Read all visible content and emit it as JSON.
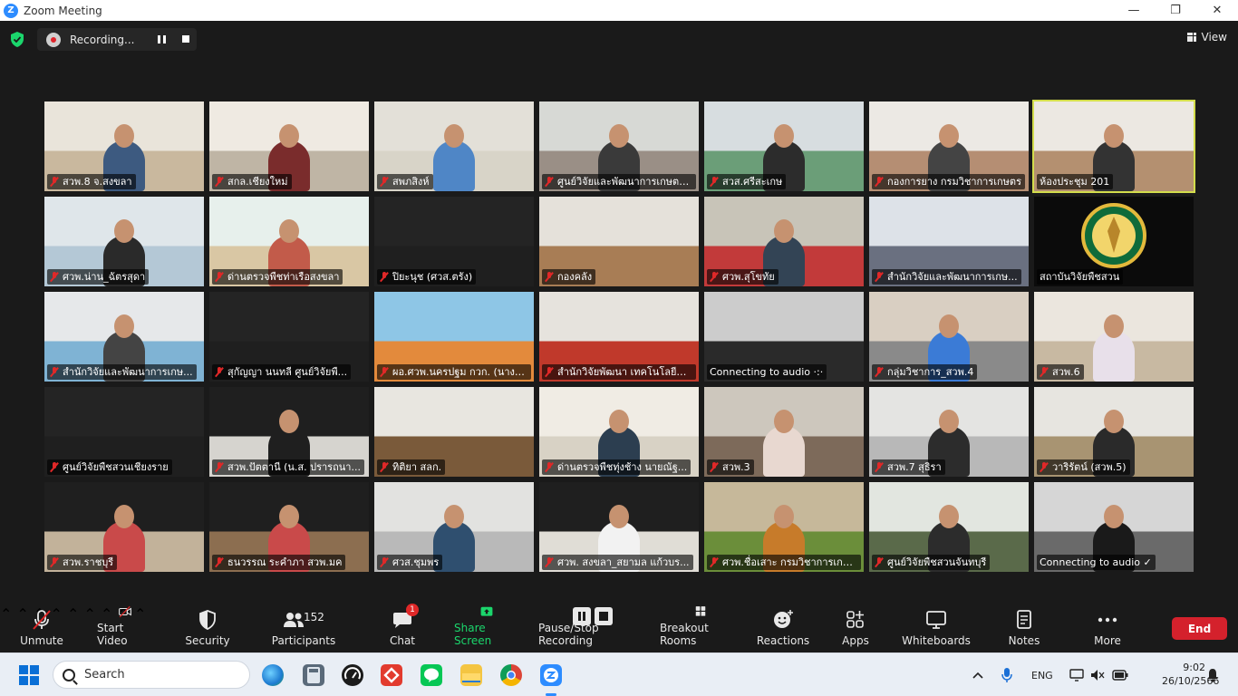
{
  "window": {
    "title": "Zoom Meeting",
    "logo_letter": "Z",
    "minimize": "—",
    "maximize": "❐",
    "close": "✕"
  },
  "topbar": {
    "recording_label": "Recording...",
    "view_label": "View"
  },
  "tiles": [
    {
      "label": "สวพ.8 จ.สงขลา",
      "muted": true,
      "bg": "#c9b89e",
      "wall": "#e9e4da",
      "person": "#3d5a80"
    },
    {
      "label": "สกล.เชียงใหม่",
      "muted": true,
      "bg": "#bfb5a5",
      "wall": "#efeae2",
      "person": "#7a2c2c"
    },
    {
      "label": "สพภสิงห์",
      "muted": true,
      "bg": "#d8d4c8",
      "wall": "#e3e0d8",
      "person": "#4f86c6"
    },
    {
      "label": "ศูนย์วิจัยและพัฒนาการเกษตร...",
      "muted": true,
      "bg": "#9a8f86",
      "wall": "#d7d9d5",
      "person": "#3a3a3a"
    },
    {
      "label": "สวส.ศรีสะเกษ",
      "muted": true,
      "bg": "#6b9e78",
      "wall": "#d7dde0",
      "person": "#2c2c2c"
    },
    {
      "label": "กองการยาง กรมวิชาการเกษตร",
      "muted": true,
      "bg": "#b58e73",
      "wall": "#ece9e4",
      "person": "#444444"
    },
    {
      "label": "ห้องประชุม 201",
      "muted": false,
      "bg": "#b49070",
      "wall": "#ece8e2",
      "person": "#333333"
    },
    {
      "label": "ศวพ.น่าน_ฉัตรสุดา",
      "muted": true,
      "bg": "#b4c8d6",
      "wall": "#dfe6ea",
      "person": "#2a2a2a"
    },
    {
      "label": "ด่านตรวจพืชท่าเรือสงขลา",
      "muted": true,
      "bg": "#d9c7a4",
      "wall": "#e7f0ec",
      "person": "#c25b4a"
    },
    {
      "label": "ปิยะนุช (ศวส.ตรัง)",
      "muted": true,
      "bg": "#1f1f1f",
      "wall": "#242424",
      "person": ""
    },
    {
      "label": "กองคลัง",
      "muted": true,
      "bg": "#a87d55",
      "wall": "#e5e1da",
      "person": ""
    },
    {
      "label": "ศวพ.สุโขทัย",
      "muted": true,
      "bg": "#c23a3a",
      "wall": "#c8c4b8",
      "person": "#334455"
    },
    {
      "label": "สำนักวิจัยและพัฒนาการเกษ...",
      "muted": true,
      "bg": "#6a7080",
      "wall": "#dde2e8",
      "person": ""
    },
    {
      "label": "สถาบันวิจัยพืชสวน",
      "muted": false,
      "bg": "#0b0b0b",
      "wall": "#0b0b0b",
      "person": "",
      "emblem": true
    },
    {
      "label": "สำนักวิจัยและพัฒนาการเกษ...",
      "muted": true,
      "bg": "#7fb3d4",
      "wall": "#e6e8ea",
      "person": "#444444"
    },
    {
      "label": "สุกัญญา นนทลี ศูนย์วิจัยพื...",
      "muted": true,
      "bg": "#1f1f1f",
      "wall": "#242424",
      "person": ""
    },
    {
      "label": "ผอ.ศวพ.นครปฐม กวก. (นางเ...",
      "muted": true,
      "bg": "#e38a3c",
      "wall": "#8ec6e6",
      "person": ""
    },
    {
      "label": "สำนักวิจัยพัฒนา เทคโนโลยีชี...",
      "muted": true,
      "bg": "#c0392b",
      "wall": "#e6e3dd",
      "person": ""
    },
    {
      "label": "Connecting to audio ·:·",
      "muted": false,
      "bg": "#2a2a2a",
      "wall": "#cccccc",
      "person": ""
    },
    {
      "label": "กลุ่มวิชาการ_สวพ.4",
      "muted": true,
      "bg": "#8a8a8a",
      "wall": "#d9cfc2",
      "person": "#3b7bd6"
    },
    {
      "label": "สวพ.6",
      "muted": true,
      "bg": "#c8b9a2",
      "wall": "#ebe6de",
      "person": "#e8e0ea"
    },
    {
      "label": "ศูนย์วิจัยพืชสวนเชียงราย",
      "muted": true,
      "bg": "#1f1f1f",
      "wall": "#242424",
      "person": ""
    },
    {
      "label": "สวพ.ปัตตานี (น.ส. ปรารถนา...",
      "muted": true,
      "bg": "#d6d4cf",
      "wall": "#1f1f1f",
      "person": "#1f1f1f"
    },
    {
      "label": "ทิติยา  สลก.",
      "muted": true,
      "bg": "#7a5a3a",
      "wall": "#e8e6e0",
      "person": ""
    },
    {
      "label": "ด่านตรวจพืชทุ่งช้าง นายณัฐ...",
      "muted": true,
      "bg": "#d8d2c5",
      "wall": "#f0ece4",
      "person": "#2c3e50"
    },
    {
      "label": "สวพ.3",
      "muted": true,
      "bg": "#7d6a5a",
      "wall": "#cdc7bd",
      "person": "#e8d8d0"
    },
    {
      "label": "สวพ.7 สุธิรา",
      "muted": true,
      "bg": "#b8b8b8",
      "wall": "#e4e4e2",
      "person": "#2c2c2c"
    },
    {
      "label": "วาริรัตน์ (สวพ.5)",
      "muted": true,
      "bg": "#a89472",
      "wall": "#e7e5e0",
      "person": "#2a2a2a"
    },
    {
      "label": "สวพ.ราชบุรี",
      "muted": true,
      "bg": "#c2b29a",
      "wall": "#1f1f1f",
      "person": "#c94a4a"
    },
    {
      "label": "ธนวรรณ ระคำภา สวพ.มค",
      "muted": true,
      "bg": "#8c6e50",
      "wall": "#1f1f1f",
      "person": "#c94a4a"
    },
    {
      "label": "ศวส.ชุมพร",
      "muted": true,
      "bg": "#b9b9b9",
      "wall": "#e2e2e0",
      "person": "#2f4f6f"
    },
    {
      "label": "ศวพ. สงขลา_สยามล แก้วบร...",
      "muted": true,
      "bg": "#e0ddd6",
      "wall": "#1f1f1f",
      "person": "#f2f2f2"
    },
    {
      "label": "ศวพ.ชื่อเสาะ กรมวิชาการเกษ...",
      "muted": true,
      "bg": "#6b8e3a",
      "wall": "#c6b89a",
      "person": "#c77b2a"
    },
    {
      "label": "ศูนย์วิจัยพืชสวนจันทบุรี",
      "muted": true,
      "bg": "#5a6a4a",
      "wall": "#e2e6e0",
      "person": "#2c2c2c"
    },
    {
      "label": "Connecting to audio ✓",
      "muted": false,
      "bg": "#6a6a6a",
      "wall": "#d6d6d6",
      "person": "#1a1a1a"
    }
  ],
  "toolbar": {
    "unmute": "Unmute",
    "start_video": "Start Video",
    "security": "Security",
    "participants_count": "152",
    "participants": "Participants",
    "chat_badge": "1",
    "chat": "Chat",
    "share_screen": "Share Screen",
    "pause_stop": "Pause/Stop Recording",
    "breakout": "Breakout Rooms",
    "reactions": "Reactions",
    "apps": "Apps",
    "whiteboards": "Whiteboards",
    "notes": "Notes",
    "more": "More",
    "end": "End"
  },
  "taskbar": {
    "search_placeholder": "Search",
    "language": "ENG",
    "time": "9:02",
    "date": "26/10/2566"
  },
  "colors": {
    "accent_green": "#1bd66c",
    "end_red": "#d4212c",
    "active_tile": "#d3dd4c",
    "zoom_blue": "#2D8CFF"
  }
}
